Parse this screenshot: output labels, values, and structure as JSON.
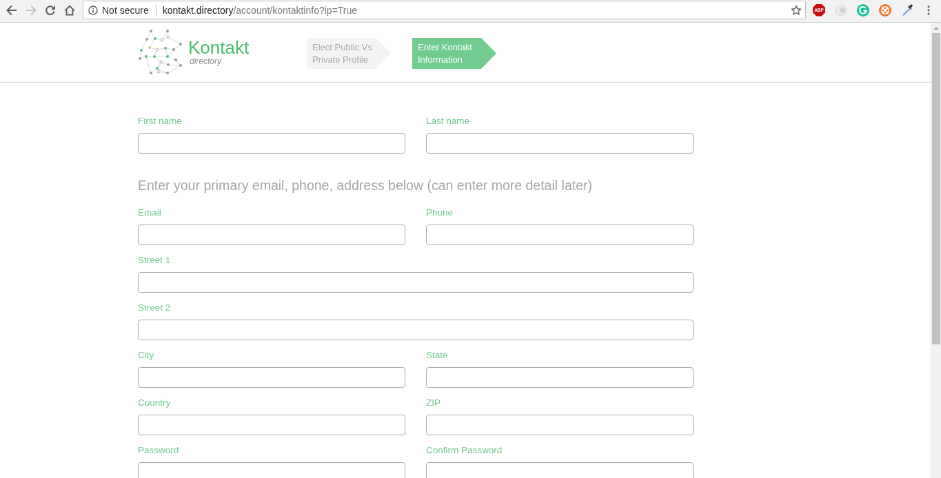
{
  "browser": {
    "nav_buttons": [
      {
        "kind": "back",
        "disabled": false
      },
      {
        "kind": "forward",
        "disabled": true
      },
      {
        "kind": "reload",
        "disabled": false
      },
      {
        "kind": "home",
        "disabled": false
      }
    ],
    "security_label": "Not secure",
    "url": {
      "host": "kontakt.directory",
      "path": "/account/kontaktinfo?ip=True"
    },
    "extensions": [
      {
        "kind": "octagon_badge",
        "label": "ABP"
      },
      {
        "kind": "swirl"
      },
      {
        "kind": "g_circle"
      },
      {
        "kind": "lifebuoy"
      },
      {
        "kind": "eyedropper"
      }
    ]
  },
  "header": {
    "logo": {
      "name": "Kontakt",
      "tagline": "directory"
    },
    "steps": [
      {
        "label": "Elect Public Vs Private Profile",
        "selected": false
      },
      {
        "label": "Enter Kontakt Information",
        "selected": true
      }
    ]
  },
  "form": {
    "name_row": [
      {
        "label": "First name"
      },
      {
        "label": "Last name"
      }
    ],
    "section_heading": "Enter your primary email, phone, address below (can enter more detail later)",
    "rows": [
      [
        {
          "label": "Email"
        },
        {
          "label": "Phone"
        }
      ],
      [
        {
          "label": "Street 1"
        }
      ],
      [
        {
          "label": "Street 2"
        }
      ],
      [
        {
          "label": "City"
        },
        {
          "label": "State"
        }
      ],
      [
        {
          "label": "Country"
        },
        {
          "label": "ZIP"
        }
      ],
      [
        {
          "label": "Password"
        },
        {
          "label": "Confirm Password"
        }
      ]
    ]
  }
}
